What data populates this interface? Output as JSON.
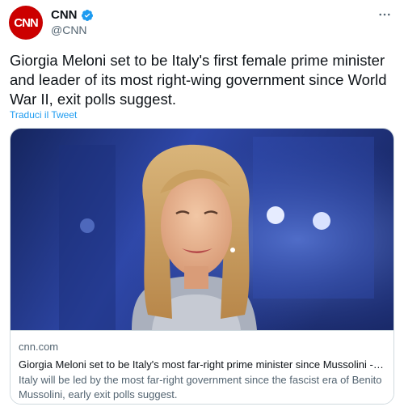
{
  "author": {
    "avatar_text": "CNN",
    "name": "CNN",
    "handle": "@CNN",
    "verified": true,
    "avatar_color": "#cc0000",
    "verified_color": "#1d9bf0"
  },
  "menu_icon": "more-horizontal-icon",
  "tweet": {
    "text": "Giorgia Meloni set to be Italy's first female prime minister and leader of its most right-wing government since World War II, exit polls suggest.",
    "translate_label": "Traduci il Tweet"
  },
  "card": {
    "domain": "cnn.com",
    "title": "Giorgia Meloni set to be Italy's most far-right prime minister since Mussolini -- ...",
    "description": "Italy will be led by the most far-right government since the fascist era of Benito Mussolini, early exit polls suggest."
  },
  "colors": {
    "link": "#1d9bf0",
    "text": "#0f1419",
    "secondary": "#536471",
    "border": "#cfd9de"
  }
}
